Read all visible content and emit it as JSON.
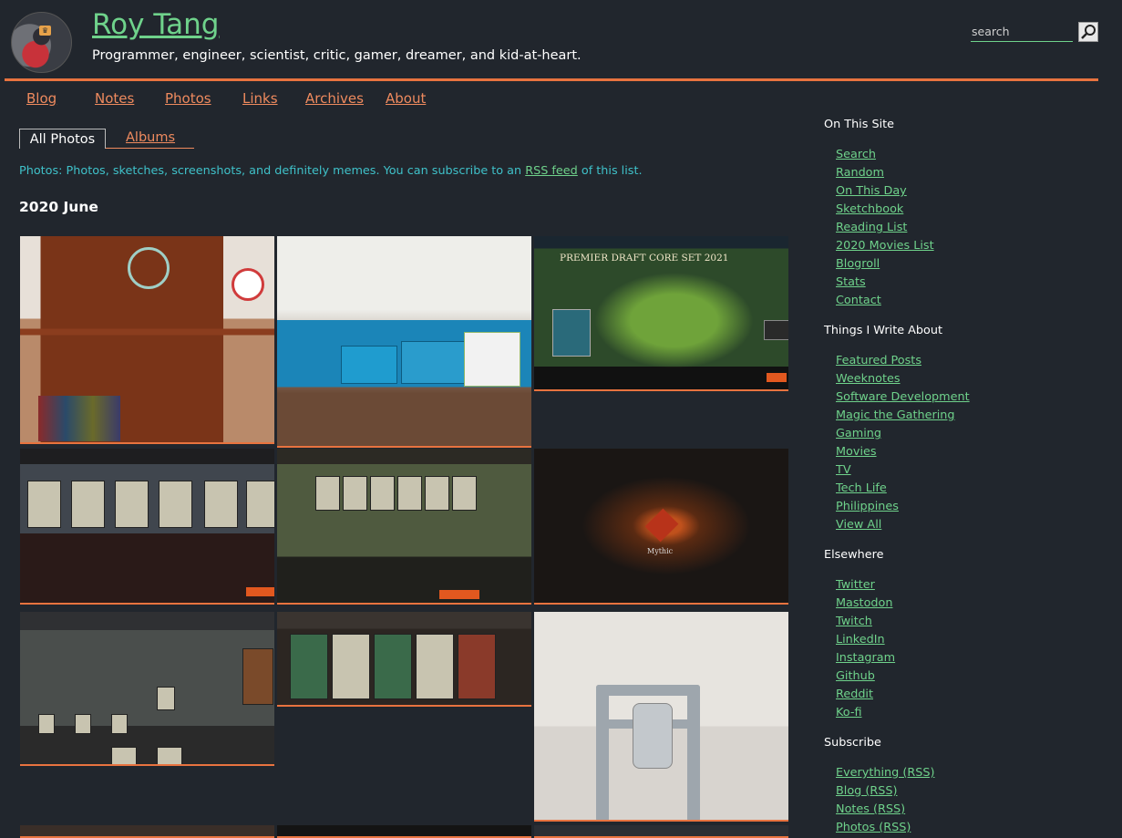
{
  "header": {
    "site_title": "Roy Tang",
    "tagline": "Programmer, engineer, scientist, critic, gamer, dreamer, and kid-at-heart.",
    "search_placeholder": "search"
  },
  "nav": [
    "Blog",
    "Notes",
    "Photos",
    "Links",
    "Archives",
    "About"
  ],
  "tabs": {
    "active": "All Photos",
    "other": "Albums"
  },
  "description": {
    "prefix": "Photos: Photos, sketches, screenshots, and definitely memes. You can subscribe to an ",
    "link": "RSS feed",
    "suffix": " of this list."
  },
  "month_heading": "2020 June",
  "photo_captions": {
    "p3_title": "PREMIER DRAFT CORE SET 2021",
    "p6_title": "Mythic"
  },
  "sidebar": {
    "sections": [
      {
        "title": "On This Site",
        "links": [
          "Search",
          "Random",
          "On This Day",
          "Sketchbook",
          "Reading List",
          "2020 Movies List",
          "Blogroll",
          "Stats",
          "Contact"
        ]
      },
      {
        "title": "Things I Write About",
        "links": [
          "Featured Posts",
          "Weeknotes",
          "Software Development",
          "Magic the Gathering",
          "Gaming",
          "Movies",
          "TV",
          "Tech Life",
          "Philippines",
          "View All"
        ]
      },
      {
        "title": "Elsewhere",
        "links": [
          "Twitter",
          "Mastodon",
          "Twitch",
          "LinkedIn",
          "Instagram",
          "Github",
          "Reddit",
          "Ko-fi"
        ]
      },
      {
        "title": "Subscribe",
        "links": [
          "Everything (RSS)",
          "Blog (RSS)",
          "Notes (RSS)",
          "Photos (RSS)"
        ]
      }
    ]
  },
  "colors": {
    "background": "#21262d",
    "accent": "#e8733f",
    "link": "#6fd28b",
    "nav_link": "#ee8a5e",
    "description": "#3fc1c9"
  }
}
